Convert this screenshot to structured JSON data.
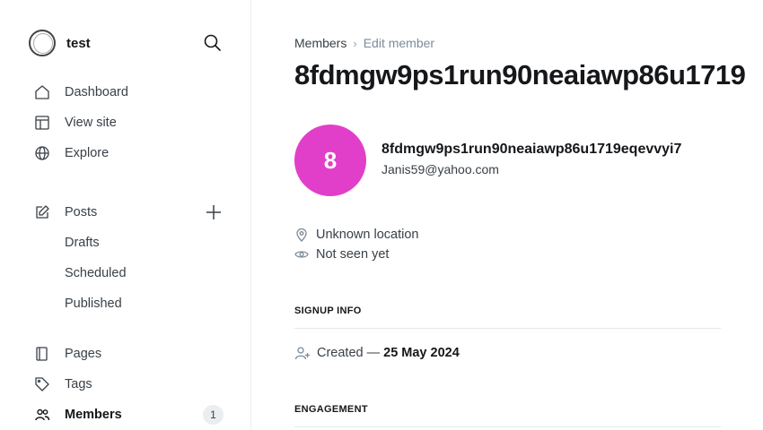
{
  "site": {
    "name": "test"
  },
  "nav": {
    "dashboard": "Dashboard",
    "view_site": "View site",
    "explore": "Explore",
    "posts": "Posts",
    "drafts": "Drafts",
    "scheduled": "Scheduled",
    "published": "Published",
    "pages": "Pages",
    "tags": "Tags",
    "members": "Members",
    "members_count": "1"
  },
  "breadcrumb": {
    "parent": "Members",
    "separator": "›",
    "current": "Edit member"
  },
  "page_title": "8fdmgw9ps1run90neaiawp86u1719",
  "member": {
    "avatar_initial": "8",
    "avatar_color": "#e13fc9",
    "name": "8fdmgw9ps1run90neaiawp86u1719eqevvyi7",
    "email": "Janis59@yahoo.com",
    "location": "Unknown location",
    "seen": "Not seen yet"
  },
  "signup": {
    "heading": "SIGNUP INFO",
    "created_label": "Created —",
    "created_date": "25 May 2024"
  },
  "engagement": {
    "heading": "ENGAGEMENT"
  }
}
